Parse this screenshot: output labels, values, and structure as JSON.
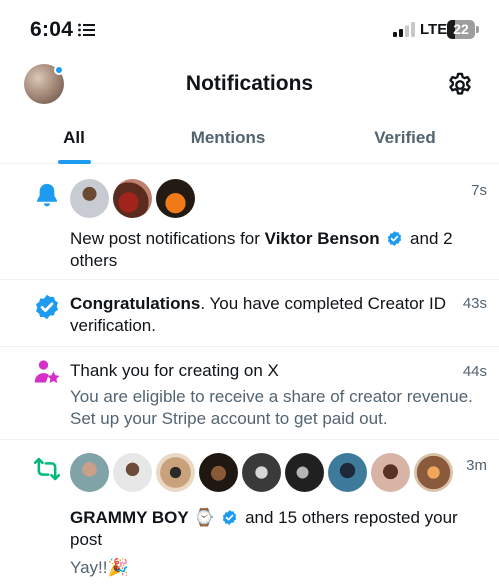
{
  "status_bar": {
    "time": "6:04",
    "network": "LTE",
    "battery": "22",
    "list_icon": "list-icon",
    "signal_icon": "signal-icon",
    "battery_icon": "battery-icon"
  },
  "header": {
    "title": "Notifications",
    "avatar_icon": "profile-avatar",
    "settings_icon": "gear-icon"
  },
  "tabs": [
    {
      "label": "All",
      "active": true
    },
    {
      "label": "Mentions",
      "active": false
    },
    {
      "label": "Verified",
      "active": false
    }
  ],
  "colors": {
    "accent": "#1d9bf0",
    "repost": "#00ba7c",
    "creator": "#d42fc7",
    "text": "#0f1419",
    "secondary": "#536471"
  },
  "notifications": [
    {
      "icon": "bell-icon",
      "time": "7s",
      "text_prefix": "New post notifications for ",
      "name": "Viktor Benson",
      "text_suffix": " and 2",
      "text_line2": "others"
    },
    {
      "icon": "verified-badge-icon",
      "time": "43s",
      "title": "Congratulations",
      "text_line1": ".  You have completed Creator ID",
      "text_line2": "verification."
    },
    {
      "icon": "creator-star-icon",
      "time": "44s",
      "title": "Thank you for creating on X",
      "sub_line1": "You are eligible to receive a share of creator revenue.",
      "sub_line2": "Set up your Stripe account to get paid out."
    },
    {
      "icon": "repost-icon",
      "time": "3m",
      "name": "GRAMMY BOY",
      "name_emoji": "⌚",
      "text_suffix": " and 15 others reposted your",
      "text_line2": "post",
      "post_text": "Yay!!🎉"
    }
  ]
}
